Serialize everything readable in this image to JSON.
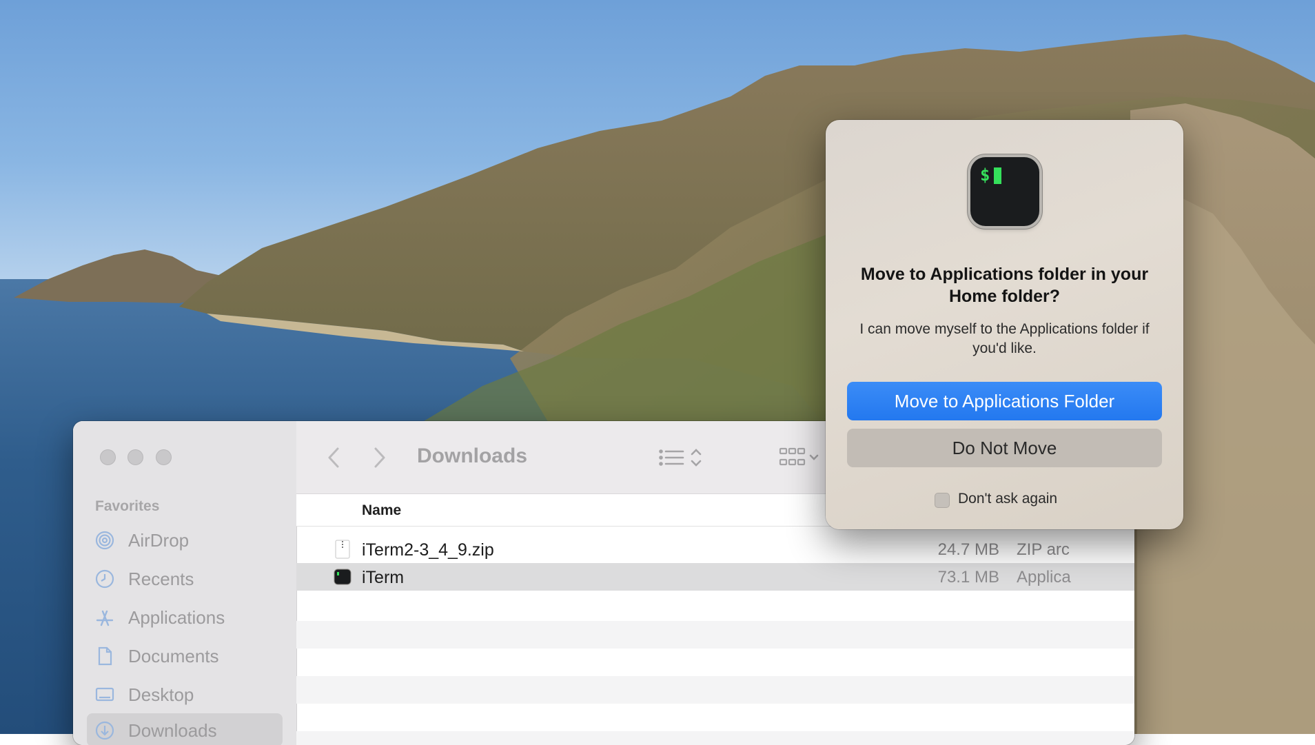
{
  "finder": {
    "sidebar": {
      "section_title": "Favorites",
      "items": [
        {
          "label": "AirDrop",
          "icon": "airdrop-icon"
        },
        {
          "label": "Recents",
          "icon": "clock-icon"
        },
        {
          "label": "Applications",
          "icon": "applications-icon"
        },
        {
          "label": "Documents",
          "icon": "document-icon"
        },
        {
          "label": "Desktop",
          "icon": "desktop-icon"
        },
        {
          "label": "Downloads",
          "icon": "downloads-icon",
          "selected": true
        }
      ]
    },
    "toolbar": {
      "title": "Downloads",
      "back_icon": "chevron-left-icon",
      "forward_icon": "chevron-right-icon",
      "view_icon": "list-view-icon",
      "group_icon": "grid-view-icon"
    },
    "columns": {
      "name": "Name"
    },
    "files": [
      {
        "name": "iTerm2-3_4_9.zip",
        "size": "24.7 MB",
        "kind": "ZIP arc",
        "icon": "zip-file-icon"
      },
      {
        "name": "iTerm",
        "size": "73.1 MB",
        "kind": "Applica",
        "icon": "iterm-app-icon",
        "selected": true
      }
    ]
  },
  "dialog": {
    "icon": "terminal-app-icon",
    "icon_glyph": "$",
    "title": "Move to Applications folder in your Home folder?",
    "message": "I can move myself to the Applications folder if you'd like.",
    "primary_button": "Move to Applications Folder",
    "secondary_button": "Do Not Move",
    "checkbox_label": "Don't ask again",
    "checkbox_checked": false,
    "accent_color": "#2a7ff2"
  }
}
